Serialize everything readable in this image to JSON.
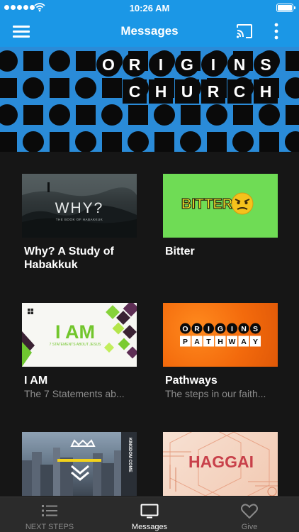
{
  "status_bar": {
    "time": "10:26 AM"
  },
  "nav": {
    "title": "Messages"
  },
  "banner": {
    "row1": [
      "O",
      "R",
      "I",
      "G",
      "I",
      "N",
      "S"
    ],
    "row2": [
      "C",
      "H",
      "U",
      "R",
      "C",
      "H"
    ]
  },
  "cards": [
    {
      "title": "Why? A Study of Habakkuk",
      "subtitle": "",
      "thumb": {
        "heading": "WHY?",
        "caption": "THE BOOK OF HABAKKUK"
      }
    },
    {
      "title": "Bitter",
      "subtitle": "",
      "thumb": {
        "heading": "BITTER"
      }
    },
    {
      "title": "I AM",
      "subtitle": "The 7 Statements ab...",
      "thumb": {
        "heading": "I AM",
        "caption": "7 STATEMENTS ABOUT JESUS"
      }
    },
    {
      "title": "Pathways",
      "subtitle": "The steps in our faith...",
      "thumb": {
        "row1": [
          "O",
          "R",
          "I",
          "G",
          "I",
          "N",
          "S"
        ],
        "row2": [
          "P",
          "A",
          "T",
          "H",
          "W",
          "A",
          "Y"
        ]
      }
    },
    {
      "title": "",
      "subtitle": "",
      "thumb": {
        "side_text": "KINGDOM COME"
      }
    },
    {
      "title": "",
      "subtitle": "",
      "thumb": {
        "heading": "HAGGAI"
      }
    }
  ],
  "tabs": [
    {
      "label": "NEXT STEPS",
      "icon": "list-icon",
      "active": false
    },
    {
      "label": "Messages",
      "icon": "monitor-icon",
      "active": true
    },
    {
      "label": "Give",
      "icon": "heart-icon",
      "active": false
    }
  ],
  "colors": {
    "accent": "#1b97e6",
    "background": "#161616",
    "tab_bar": "#2b2b2b",
    "inactive": "#8a8a8a"
  }
}
